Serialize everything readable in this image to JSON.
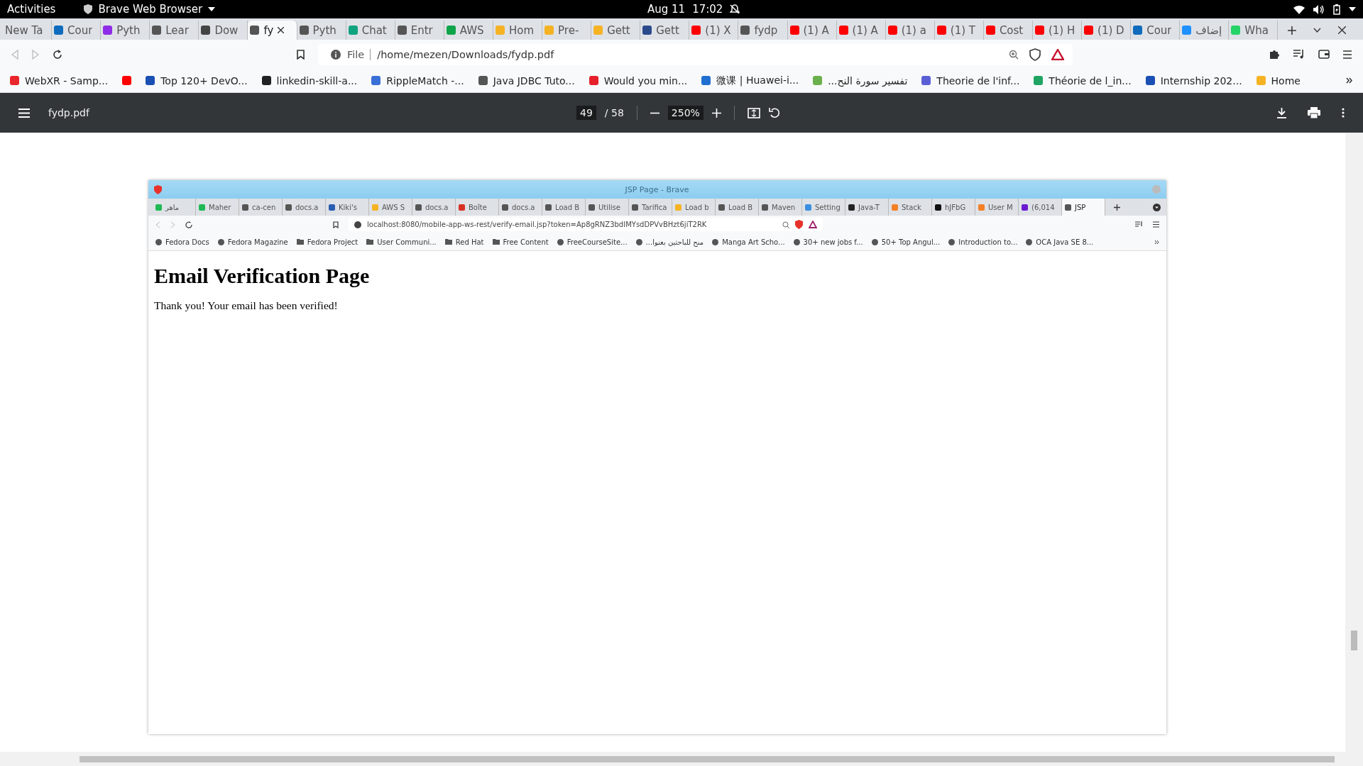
{
  "system_bar": {
    "activities": "Activities",
    "app_name": "Brave Web Browser",
    "date": "Aug 11",
    "time": "17:02"
  },
  "tabs": [
    {
      "label": "New Ta",
      "selected": false
    },
    {
      "label": "Cour",
      "selected": false,
      "color": "#0f6cbd"
    },
    {
      "label": "Pyth",
      "selected": false,
      "color": "#8e2ce8"
    },
    {
      "label": "Lear",
      "selected": false,
      "color": "#555555"
    },
    {
      "label": "Dow",
      "selected": false,
      "color": "#444444"
    },
    {
      "label": "fy",
      "selected": true,
      "color": "#555555"
    },
    {
      "label": "Pyth",
      "selected": false,
      "color": "#555555"
    },
    {
      "label": "Chat",
      "selected": false,
      "color": "#10a37f"
    },
    {
      "label": "Entr",
      "selected": false,
      "color": "#555555"
    },
    {
      "label": "AWS",
      "selected": false,
      "color": "#0fa44a"
    },
    {
      "label": "Hom",
      "selected": false,
      "color": "#f5b324"
    },
    {
      "label": "Pre-",
      "selected": false,
      "color": "#f5b324"
    },
    {
      "label": "Gett",
      "selected": false,
      "color": "#f5b324"
    },
    {
      "label": "Gett",
      "selected": false,
      "color": "#2b4a8c"
    },
    {
      "label": "(1) X",
      "selected": false,
      "color": "#ff0000"
    },
    {
      "label": "fydp",
      "selected": false,
      "color": "#555555"
    },
    {
      "label": "(1) A",
      "selected": false,
      "color": "#ff0000"
    },
    {
      "label": "(1) A",
      "selected": false,
      "color": "#ff0000"
    },
    {
      "label": "(1) a",
      "selected": false,
      "color": "#ff0000"
    },
    {
      "label": "(1) T",
      "selected": false,
      "color": "#ff0000"
    },
    {
      "label": "Cost",
      "selected": false,
      "color": "#ff0000"
    },
    {
      "label": "(1) H",
      "selected": false,
      "color": "#ff0000"
    },
    {
      "label": "(1) D",
      "selected": false,
      "color": "#ff0000"
    },
    {
      "label": "Cour",
      "selected": false,
      "color": "#0f6cbd"
    },
    {
      "label": "إضاف",
      "selected": false,
      "color": "#1e90ff"
    },
    {
      "label": "Wha",
      "selected": false,
      "color": "#25d366"
    }
  ],
  "address_bar": {
    "scheme": "File",
    "url": "/home/mezen/Downloads/fydp.pdf"
  },
  "bookmarks": [
    {
      "label": "WebXR - Samp...",
      "color": "#e8262b"
    },
    {
      "color": "#ff0000"
    },
    {
      "label": "Top 120+ DevO...",
      "color": "#1a4fb4"
    },
    {
      "label": "linkedin-skill-a...",
      "color": "#222222"
    },
    {
      "label": "RippleMatch -...",
      "color": "#3a6fd8"
    },
    {
      "label": "Java JDBC Tuto...",
      "color": "#555555"
    },
    {
      "label": "Would you min...",
      "color": "#e5202b"
    },
    {
      "label": "微课 | Huawei-i...",
      "color": "#1f6fd1"
    },
    {
      "label": "تفسير سورة النح...",
      "color": "#6ab04c"
    },
    {
      "label": "Theorie de l'inf...",
      "color": "#5b5fd6"
    },
    {
      "label": "Théorie de l_in...",
      "color": "#1fa463"
    },
    {
      "label": "Internship 202...",
      "color": "#1a4fb4"
    },
    {
      "label": "Home",
      "color": "#f5b324"
    }
  ],
  "pdf_toolbar": {
    "file_name": "fydp.pdf",
    "page": "49",
    "page_total": "/ 58",
    "zoom": "250%"
  },
  "document_page": {
    "window_title": "JSP Page - Brave",
    "tabs": [
      {
        "label": "ماهر",
        "selected": false,
        "color": "#1db954"
      },
      {
        "label": "Maher",
        "selected": false,
        "color": "#1db954"
      },
      {
        "label": "ca-cen",
        "selected": false,
        "color": "#555555"
      },
      {
        "label": "docs.a",
        "selected": false,
        "color": "#555555"
      },
      {
        "label": "Kiki's",
        "selected": false,
        "color": "#2a5db0"
      },
      {
        "label": "AWS S",
        "selected": false,
        "color": "#f5b324"
      },
      {
        "label": "docs.a",
        "selected": false,
        "color": "#555555"
      },
      {
        "label": "Boîte",
        "selected": false,
        "color": "#d93025"
      },
      {
        "label": "docs.a",
        "selected": false,
        "color": "#555555"
      },
      {
        "label": "Load B",
        "selected": false,
        "color": "#555555"
      },
      {
        "label": "Utilise",
        "selected": false,
        "color": "#555555"
      },
      {
        "label": "Tarifica",
        "selected": false,
        "color": "#555555"
      },
      {
        "label": "Load b",
        "selected": false,
        "color": "#f5b324"
      },
      {
        "label": "Load B",
        "selected": false,
        "color": "#555555"
      },
      {
        "label": "Maven",
        "selected": false,
        "color": "#555555"
      },
      {
        "label": "Setting",
        "selected": false,
        "color": "#3b8fe0"
      },
      {
        "label": "Java-T",
        "selected": false,
        "color": "#222222"
      },
      {
        "label": "Stack",
        "selected": false,
        "color": "#f48024"
      },
      {
        "label": "hJFbG",
        "selected": false,
        "color": "#111111"
      },
      {
        "label": "User M",
        "selected": false,
        "color": "#f48024"
      },
      {
        "label": "(6,014",
        "selected": false,
        "color": "#6a1bd1"
      },
      {
        "label": "JSP",
        "selected": true,
        "color": "#555555"
      }
    ],
    "url": "localhost:8080/mobile-app-ws-rest/verify-email.jsp?token=Ap8gRNZ3bdIMYsdDPVvBHzt6jiT2RK",
    "bookmarks": [
      {
        "label": "Fedora Docs",
        "kind": "site"
      },
      {
        "label": "Fedora Magazine",
        "kind": "site"
      },
      {
        "label": "Fedora Project",
        "kind": "folder"
      },
      {
        "label": "User Communi...",
        "kind": "folder"
      },
      {
        "label": "Red Hat",
        "kind": "folder"
      },
      {
        "label": "Free Content",
        "kind": "folder"
      },
      {
        "label": "FreeCourseSite...",
        "kind": "site"
      },
      {
        "label": "منح للباحثين بعنوا...",
        "kind": "site"
      },
      {
        "label": "Manga Art Scho...",
        "kind": "site"
      },
      {
        "label": "30+ new jobs f...",
        "kind": "site"
      },
      {
        "label": "50+ Top Angul...",
        "kind": "site"
      },
      {
        "label": "Introduction to...",
        "kind": "site"
      },
      {
        "label": "OCA Java SE 8...",
        "kind": "site"
      }
    ],
    "heading": "Email Verification Page",
    "message": "Thank you! Your email has been verified!"
  }
}
